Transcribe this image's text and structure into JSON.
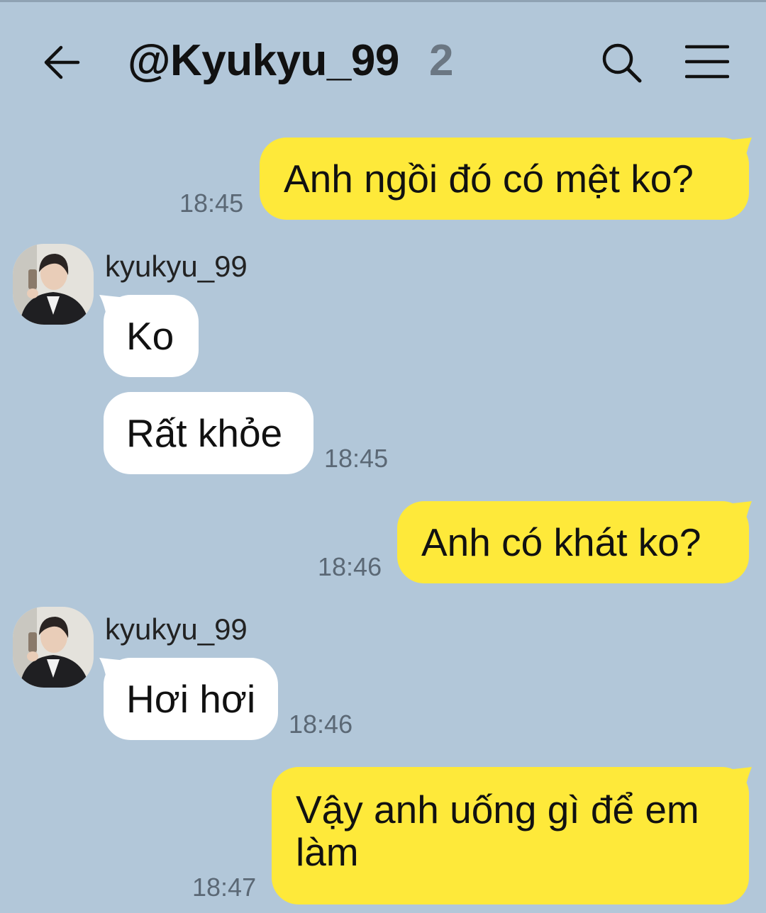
{
  "header": {
    "title": "@Kyukyu_99",
    "member_count": "2",
    "back_icon": "arrow-left-icon",
    "search_icon": "search-icon",
    "menu_icon": "hamburger-menu-icon"
  },
  "colors": {
    "background": "#b2c7d9",
    "my_bubble": "#fee93a",
    "their_bubble": "#ffffff"
  },
  "messages": [
    {
      "from": "me",
      "text": "Anh ngồi đó có mệt ko?",
      "time": "18:45"
    },
    {
      "from": "kyukyu_99",
      "sender": "kyukyu_99",
      "text": "Ko"
    },
    {
      "from": "kyukyu_99",
      "text": "Rất khỏe",
      "time": "18:45"
    },
    {
      "from": "me",
      "text": "Anh có khát ko?",
      "time": "18:46"
    },
    {
      "from": "kyukyu_99",
      "sender": "kyukyu_99",
      "text": "Hơi hơi",
      "time": "18:46"
    },
    {
      "from": "me",
      "text": "Vậy anh uống gì để em làm",
      "time": "18:47"
    }
  ]
}
